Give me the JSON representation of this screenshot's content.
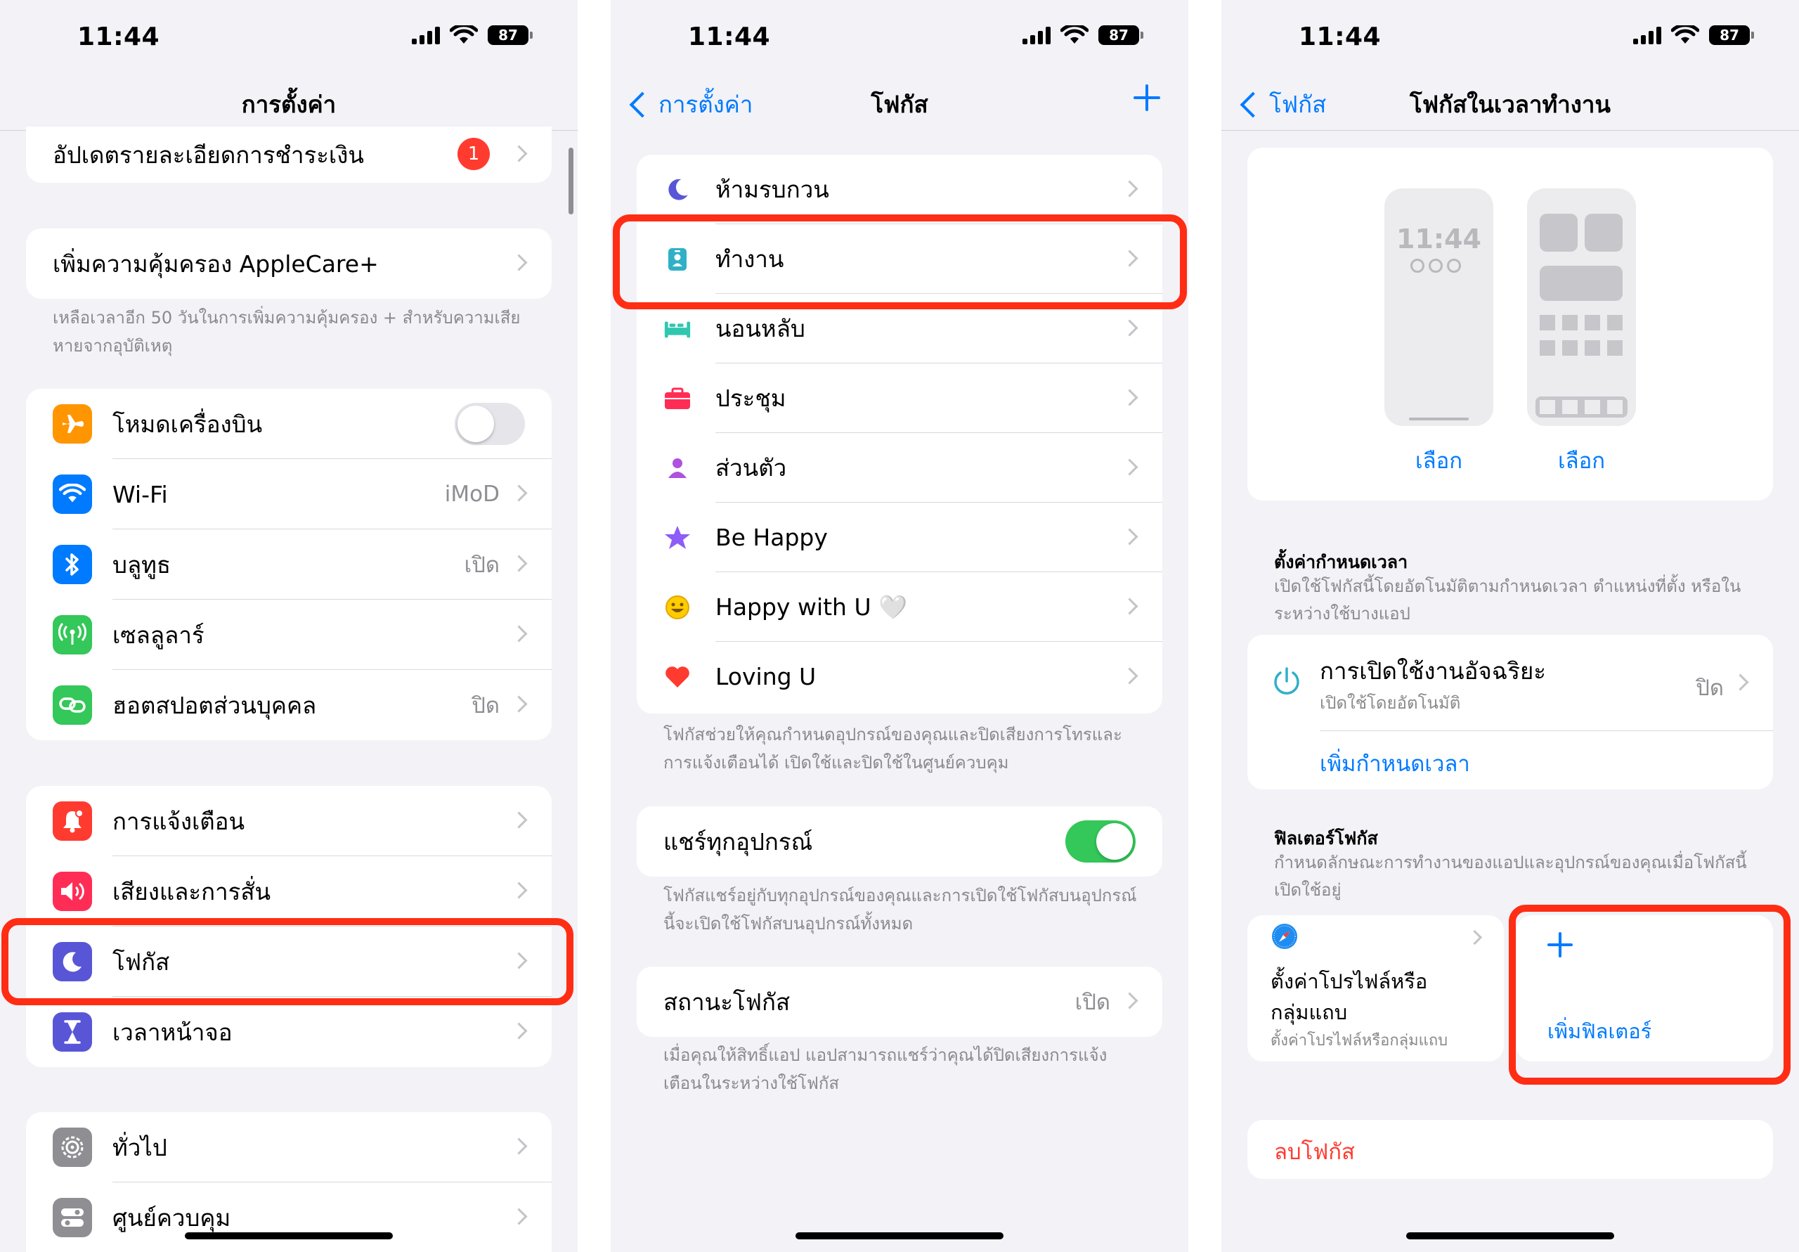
{
  "status": {
    "time": "11:44",
    "battery": "87"
  },
  "panel1": {
    "title": "การตั้งค่า",
    "payment_label": "อัปเดตรายละเอียดการชำระเงิน",
    "payment_badge": "1",
    "applecare_label": "เพิ่มความคุ้มครอง AppleCare+",
    "applecare_footer": "เหลือเวลาอีก 50 วันในการเพิ่มความคุ้มครอง + สำหรับความเสียหายจากอุบัติเหตุ",
    "connectivity": [
      {
        "label": "โหมดเครื่องบิน",
        "value": ""
      },
      {
        "label": "Wi-Fi",
        "value": "iMoD"
      },
      {
        "label": "บลูทูธ",
        "value": "เปิด"
      },
      {
        "label": "เซลลูลาร์",
        "value": ""
      },
      {
        "label": "ฮอตสปอตส่วนบุคคล",
        "value": "ปิด"
      }
    ],
    "notifications": [
      {
        "label": "การแจ้งเตือน"
      },
      {
        "label": "เสียงและการสั่น"
      },
      {
        "label": "โฟกัส"
      },
      {
        "label": "เวลาหน้าจอ"
      }
    ],
    "general": [
      {
        "label": "ทั่วไป"
      },
      {
        "label": "ศูนย์ควบคุม"
      }
    ]
  },
  "panel2": {
    "back_label": "การตั้งค่า",
    "title": "โฟกัส",
    "modes": [
      {
        "label": "ห้ามรบกวน"
      },
      {
        "label": "ทำงาน"
      },
      {
        "label": "นอนหลับ"
      },
      {
        "label": "ประชุม"
      },
      {
        "label": "ส่วนตัว"
      },
      {
        "label": "Be Happy"
      },
      {
        "label": "Happy with U 🤍"
      },
      {
        "label": "Loving U"
      }
    ],
    "modes_footer": "โฟกัสช่วยให้คุณกำหนดอุปกรณ์ของคุณและปิดเสียงการโทรและการแจ้งเตือนได้ เปิดใช้และปิดใช้ในศูนย์ควบคุม",
    "share_label": "แชร์ทุกอุปกรณ์",
    "share_footer": "โฟกัสแชร์อยู่กับทุกอุปกรณ์ของคุณและการเปิดใช้โฟกัสบนอุปกรณ์นี้จะเปิดใช้โฟกัสบนอุปกรณ์ทั้งหมด",
    "status_label": "สถานะโฟกัส",
    "status_value": "เปิด",
    "status_footer": "เมื่อคุณให้สิทธิ์แอป แอปสามารถแชร์ว่าคุณได้ปิดเสียงการแจ้งเตือนในระหว่างใช้โฟกัส"
  },
  "panel3": {
    "back_label": "โฟกัส",
    "title": "โฟกัสในเวลาทำงาน",
    "preview_time": "11:44",
    "choose_1": "เลือก",
    "choose_2": "เลือก",
    "schedule_header": "ตั้งค่ากำหนดเวลา",
    "schedule_sub": "เปิดใช้โฟกัสนี้โดยอัตโนมัติตามกำหนดเวลา ตำแหน่งที่ตั้ง หรือในระหว่างใช้บางแอป",
    "smart_title": "การเปิดใช้งานอัจฉริยะ",
    "smart_sub": "เปิดใช้โดยอัตโนมัติ",
    "smart_value": "ปิด",
    "add_schedule": "เพิ่มกำหนดเวลา",
    "filter_header": "ฟิลเตอร์โฟกัส",
    "filter_sub": "กำหนดลักษณะการทำงานของแอปและอุปกรณ์ของคุณเมื่อโฟกัสนี้เปิดใช้อยู่",
    "profile_title_1": "ตั้งค่าโปรไฟล์หรือ",
    "profile_title_2": "กลุ่มแถบ",
    "profile_sub": "ตั้งค่าโปรไฟล์หรือกลุ่มแถบ",
    "add_filter": "เพิ่มฟิลเตอร์",
    "delete_focus": "ลบโฟกัส"
  },
  "colors": {
    "accent": "#007aff",
    "highlight": "#ff2d14",
    "toggle_on": "#34c759",
    "badge": "#ff3b30",
    "airplane": "#ff9500",
    "wifi": "#007aff",
    "bluetooth": "#007aff",
    "cellular": "#34c759",
    "hotspot": "#34c759",
    "notifications": "#ff3b30",
    "sounds": "#ff2d55",
    "focus": "#5856d6",
    "screen_time": "#5856d6",
    "general": "#8e8e93",
    "work": "#30b0c7",
    "sleep": "#30c7b0",
    "meeting": "#ff2d55",
    "personal": "#af52de",
    "behappy": "#8e5cf7",
    "happywithu": "#ffcc00",
    "lovingu": "#ff3b30"
  },
  "icons": {
    "airplane": "airplane-icon",
    "wifi": "wifi-icon",
    "bluetooth": "bluetooth-icon",
    "cellular": "antenna-icon",
    "hotspot": "link-icon",
    "notifications": "bell-icon",
    "sounds": "speaker-icon",
    "focus": "moon-icon",
    "screen_time": "hourglass-icon",
    "general": "gear-icon",
    "control_center": "switches-icon"
  }
}
